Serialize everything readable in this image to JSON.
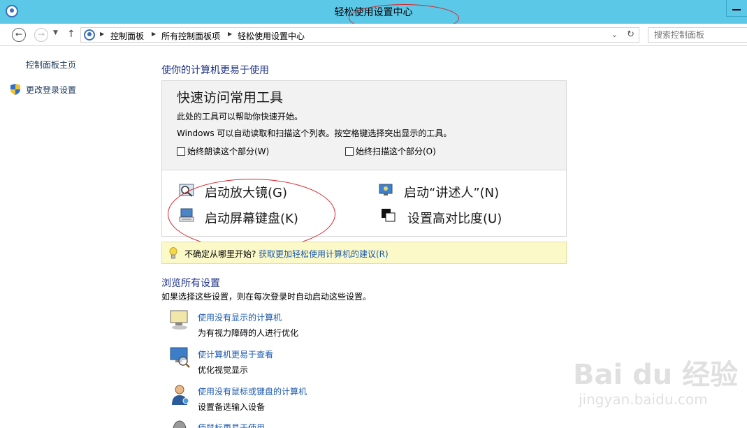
{
  "window": {
    "title": "轻松使用设置中心"
  },
  "address": {
    "crumbs": [
      "控制面板",
      "所有控制面板项",
      "轻松使用设置中心"
    ],
    "search_placeholder": "搜索控制面板"
  },
  "left_nav": {
    "home": "控制面板主页",
    "login_settings": "更改登录设置"
  },
  "main": {
    "title": "使你的计算机更易于使用",
    "quick": {
      "heading": "快速访问常用工具",
      "line1": "此处的工具可以帮助你快速开始。",
      "line2": "Windows 可以自动读取和扫描这个列表。按空格键选择突出显示的工具。",
      "check1": "始终朗读这个部分(W)",
      "check2": "始终扫描这个部分(O)",
      "tools": {
        "magnifier": "启动放大镜(G)",
        "narrator": "启动“讲述人”(N)",
        "osk": "启动屏幕键盘(K)",
        "contrast": "设置高对比度(U)"
      }
    },
    "tip": {
      "text": "不确定从哪里开始?",
      "link": "获取更加轻松使用计算机的建议(R)"
    },
    "browse": {
      "title": "浏览所有设置",
      "subtitle": "如果选择这些设置，则在每次登录时自动启动这些设置。",
      "items": [
        {
          "link": "使用没有显示的计算机",
          "desc": "为有视力障碍的人进行优化"
        },
        {
          "link": "使计算机更易于查看",
          "desc": "优化视觉显示"
        },
        {
          "link": "使用没有鼠标或键盘的计算机",
          "desc": "设置备选输入设备"
        },
        {
          "link": "使鼠标更易于使用"
        }
      ]
    }
  },
  "watermark": {
    "line1": "Bai du 经验",
    "line2": "jingyan.baidu.com"
  },
  "colors": {
    "titlebar": "#5bc8e8",
    "link": "#1c5aad",
    "heading": "#1e3287",
    "annotation": "#d9222a",
    "tip_bg": "#fbf9c8"
  }
}
